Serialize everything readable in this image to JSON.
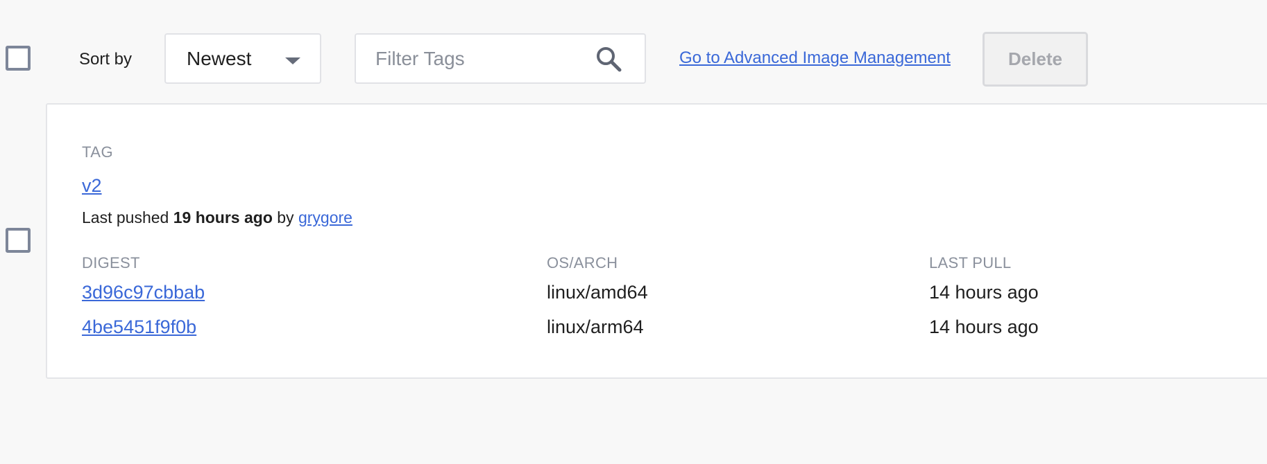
{
  "toolbar": {
    "sort_label": "Sort by",
    "sort_value": "Newest",
    "filter_placeholder": "Filter Tags",
    "advanced_link": "Go to Advanced Image Management",
    "delete_label": "Delete"
  },
  "tag_card": {
    "tag_header": "TAG",
    "tag_name": "v2",
    "pushed_prefix": "Last pushed",
    "pushed_time": "19 hours ago",
    "pushed_by": "by",
    "pushed_user": "grygore",
    "columns": {
      "digest": "DIGEST",
      "os_arch": "OS/ARCH",
      "last_pull": "LAST PULL"
    },
    "rows": [
      {
        "digest": "3d96c97cbbab",
        "os_arch": "linux/amd64",
        "last_pull": "14 hours ago"
      },
      {
        "digest": "4be5451f9f0b",
        "os_arch": "linux/arm64",
        "last_pull": "14 hours ago"
      }
    ]
  },
  "colors": {
    "link": "#3a68d8",
    "muted": "#8a909c",
    "background": "#f8f8f8"
  }
}
